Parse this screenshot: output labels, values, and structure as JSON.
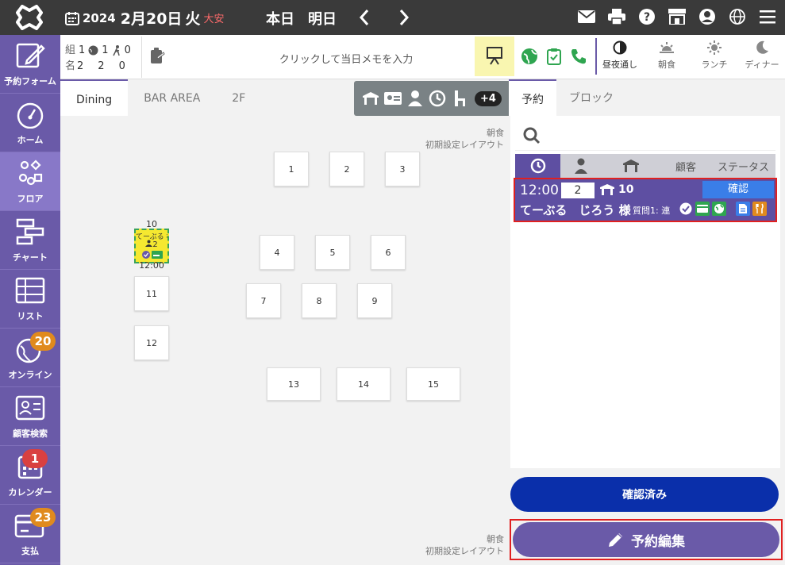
{
  "header": {
    "year": "2024",
    "month_day": "2月20日",
    "weekday": "火",
    "rokuyo": "大安",
    "today_label": "本日",
    "tomorrow_label": "明日"
  },
  "sidebar": {
    "items": [
      {
        "label": "予約フォーム"
      },
      {
        "label": "ホーム"
      },
      {
        "label": "フロア"
      },
      {
        "label": "チャート"
      },
      {
        "label": "リスト"
      },
      {
        "label": "オンライン",
        "badge": "20"
      },
      {
        "label": "顧客検索"
      },
      {
        "label": "カレンダー",
        "badge": "1"
      },
      {
        "label": "支払",
        "badge": "23"
      }
    ]
  },
  "counts": {
    "groups_label": "組",
    "people_label": "名",
    "row1": [
      "1",
      "1",
      "0"
    ],
    "row2": [
      "2",
      "2",
      "0"
    ]
  },
  "memo_placeholder": "クリックして当日メモを入力",
  "meal_tabs": [
    {
      "label": "昼夜通し"
    },
    {
      "label": "朝食"
    },
    {
      "label": "ランチ"
    },
    {
      "label": "ディナー"
    }
  ],
  "floor": {
    "tabs": [
      "Dining",
      "BAR AREA",
      "2F"
    ],
    "filter_more": "+4",
    "layout_top": {
      "meal": "朝食",
      "layout": "初期設定レイアウト"
    },
    "layout_bottom": {
      "meal": "朝食",
      "layout": "初期設定レイアウト"
    },
    "tables": [
      "1",
      "2",
      "3",
      "4",
      "5",
      "6",
      "7",
      "8",
      "9",
      "11",
      "12",
      "13",
      "14",
      "15"
    ],
    "reserved_table": {
      "number": "10",
      "name": "てーぶる 様",
      "party": "2",
      "time": "12:00"
    }
  },
  "right_panel": {
    "tabs": [
      "予約",
      "ブロック"
    ],
    "columns": [
      "顧客",
      "ステータス"
    ],
    "reservation": {
      "time": "12:00",
      "party": "2",
      "table": "10",
      "status": "確認",
      "name": "てーぶる　じろう 様",
      "question": "質問1: 連"
    }
  },
  "buttons": {
    "confirmed": "確認済み",
    "edit": "予約編集"
  },
  "colors": {
    "sidebar": "#6a5aa8",
    "topbar": "#3a3a3a",
    "accent_blue": "#0a2faa",
    "status_blue": "#3a7ee8",
    "highlight_red": "#e02020"
  }
}
